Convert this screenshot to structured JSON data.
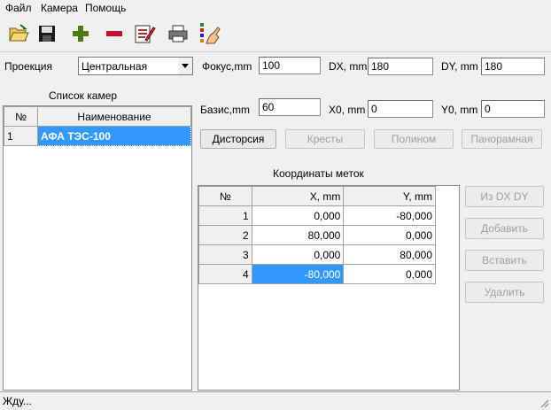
{
  "menu": [
    "Файл",
    "Камера",
    "Помощь"
  ],
  "toolbar_icons": [
    "open-folder-icon",
    "save-icon",
    "add-icon",
    "remove-icon",
    "edit-document-icon",
    "print-icon",
    "report-hand-icon"
  ],
  "params": {
    "projection_label": "Проекция",
    "projection_value": "Центральная",
    "focus_label": "Фокус,mm",
    "focus_value": "100",
    "dx_label": "DX, mm",
    "dx_value": "180",
    "dy_label": "DY, mm",
    "dy_value": "180",
    "basis_label": "Базис,mm",
    "basis_value": "60",
    "x0_label": "X0, mm",
    "x0_value": "0",
    "y0_label": "Y0, mm",
    "y0_value": "0"
  },
  "cameras": {
    "title": "Список камер",
    "col_num": "№",
    "col_name": "Наименование",
    "rows": [
      {
        "num": "1",
        "name": "АФА ТЭС-100"
      }
    ]
  },
  "buttons": {
    "distortion": "Дисторсия",
    "crosses": "Кресты",
    "polynom": "Полином",
    "panoramic": "Панорамная",
    "from_dxdy": "Из DX DY",
    "add": "Добавить",
    "insert": "Вставить",
    "delete": "Удалить"
  },
  "marks": {
    "title": "Координаты меток",
    "col_num": "№",
    "col_x": "X, mm",
    "col_y": "Y, mm",
    "rows": [
      {
        "num": "1",
        "x": "0,000",
        "y": "-80,000"
      },
      {
        "num": "2",
        "x": "80,000",
        "y": "0,000"
      },
      {
        "num": "3",
        "x": "0,000",
        "y": "80,000"
      },
      {
        "num": "4",
        "x": "-80,000",
        "y": "0,000"
      }
    ]
  },
  "status": "Жду...",
  "colors": {
    "selection": "#3399ff"
  }
}
